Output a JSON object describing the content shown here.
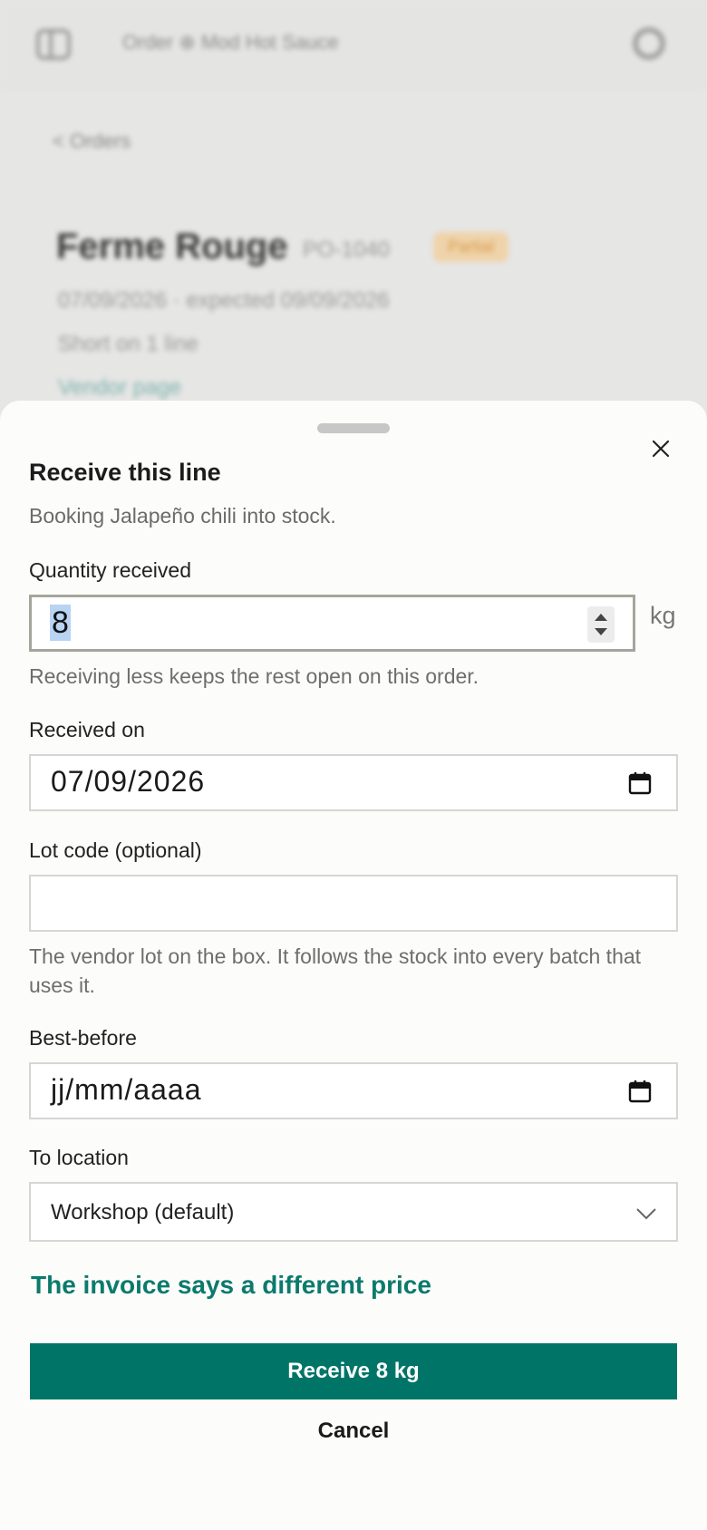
{
  "background": {
    "header_title": "Order ⊕ Mod Hot Sauce",
    "back_link": "< Orders",
    "vendor_name": "Ferme Rouge",
    "po_number": "PO-1040",
    "status_badge": "Partial",
    "dates": "07/09/2026 · expected 09/09/2026",
    "short_note": "Short on 1 line",
    "vendor_page_link": "Vendor page"
  },
  "sheet": {
    "title": "Receive this line",
    "subtitle": "Booking Jalapeño chili into stock.",
    "quantity": {
      "label": "Quantity received",
      "value": "8",
      "unit": "kg",
      "help": "Receiving less keeps the rest open on this order."
    },
    "received_on": {
      "label": "Received on",
      "value": "07/09/2026"
    },
    "lot_code": {
      "label": "Lot code (optional)",
      "value": "",
      "help": "The vendor lot on the box. It follows the stock into every batch that uses it."
    },
    "best_before": {
      "label": "Best-before",
      "placeholder": "jj/mm/aaaa"
    },
    "to_location": {
      "label": "To location",
      "value": "Workshop (default)"
    },
    "price_link": "The invoice says a different price",
    "primary_button": "Receive 8 kg",
    "cancel_button": "Cancel"
  },
  "colors": {
    "accent": "#007567",
    "link": "#0b7a6c",
    "badge_bg": "#efd3aa"
  },
  "icons": [
    "menu-icon",
    "settings-icon",
    "close-icon",
    "calendar-icon",
    "chevron-down-icon"
  ]
}
